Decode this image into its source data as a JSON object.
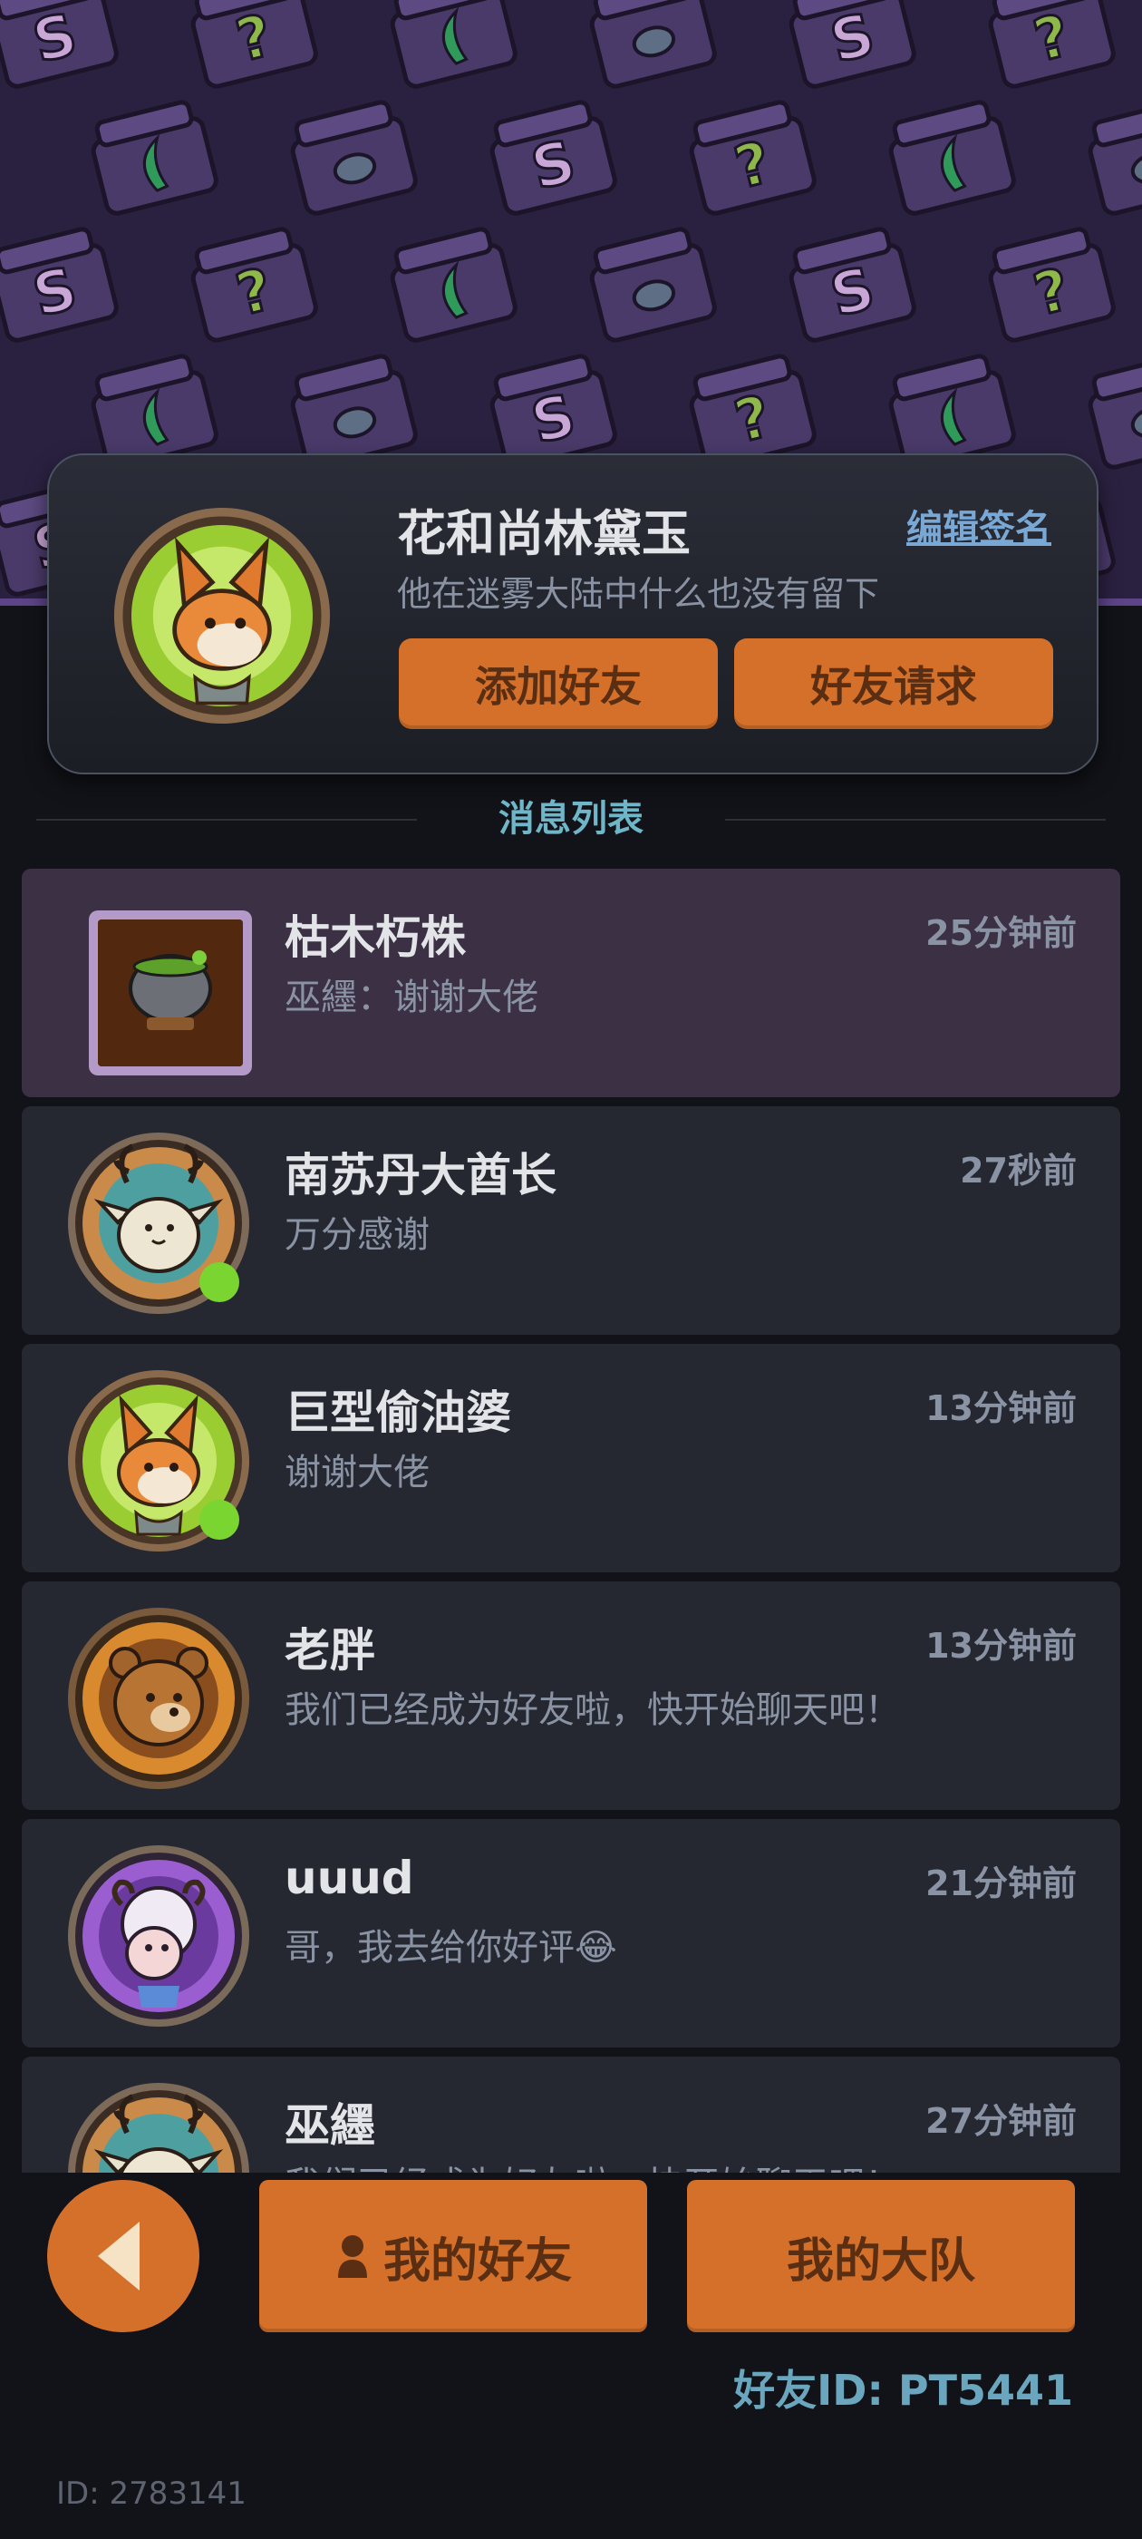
{
  "colors": {
    "accent_orange": "#d5702a",
    "button_text": "#5a2e12",
    "section_title": "#6fb6c8",
    "online_dot": "#7bd531",
    "selected_row": "#3c3044",
    "row_bg": "#252731"
  },
  "banner": {
    "glyph_question": "?",
    "glyph_s": "S"
  },
  "profile": {
    "name": "花和尚林黛玉",
    "signature": "他在迷雾大陆中什么也没有留下",
    "edit_label": "编辑签名",
    "avatar_icon": "fox-avatar-icon",
    "add_friend_label": "添加好友",
    "friend_request_label": "好友请求"
  },
  "section": {
    "title": "消息列表"
  },
  "messages": [
    {
      "name": "枯木朽株",
      "text": "巫纆：谢谢大佬",
      "time": "25分钟前",
      "avatar": "cauldron-icon",
      "online": false,
      "selected": true
    },
    {
      "name": "南苏丹大酋长",
      "text": "万分感谢",
      "time": "27秒前",
      "avatar": "antler-cat-avatar-icon",
      "online": true,
      "selected": false
    },
    {
      "name": "巨型偷油婆",
      "text": "谢谢大佬",
      "time": "13分钟前",
      "avatar": "fox-avatar-icon",
      "online": true,
      "selected": false
    },
    {
      "name": "老胖",
      "text": "我们已经成为好友啦，快开始聊天吧！",
      "time": "13分钟前",
      "avatar": "bear-avatar-icon",
      "online": false,
      "selected": false
    },
    {
      "name": "uuud",
      "text": "哥，我去给你好评😂",
      "time": "21分钟前",
      "avatar": "sheep-avatar-icon",
      "online": false,
      "selected": false
    },
    {
      "name": "巫纆",
      "text": "我们已经成为好友啦，快开始聊天吧！",
      "time": "27分钟前",
      "avatar": "antler-cat-avatar-icon",
      "online": false,
      "selected": false
    }
  ],
  "nav": {
    "back_icon": "back-arrow-icon",
    "my_friends_label": "我的好友",
    "my_friends_icon": "person-icon",
    "my_team_label": "我的大队"
  },
  "footer": {
    "friend_id": "好友ID: PT5441",
    "user_id": "ID: 2783141"
  }
}
